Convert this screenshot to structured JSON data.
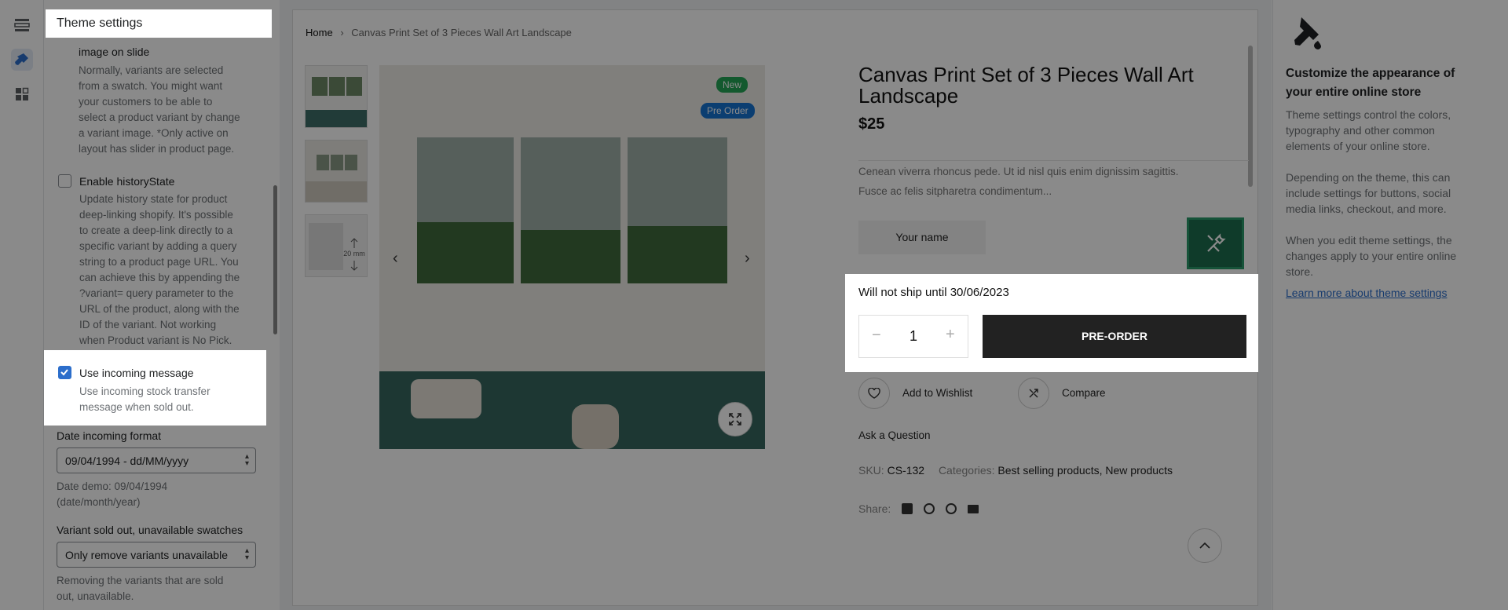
{
  "settings": {
    "title": "Theme settings",
    "variant_image_label": "image on slide",
    "variant_image_help": [
      "Normally, variants are selected",
      "from a swatch. You might want",
      "your customers to be able to",
      "select a product variant by change",
      "a variant image. *Only active on",
      "layout has slider in product page."
    ],
    "history_label": "Enable historyState",
    "history_help": [
      "Update history state for product",
      "deep-linking shopify. It's possible",
      "to create a deep-link directly to a",
      "specific variant by adding a query",
      "string to a product page URL. You",
      "can achieve this by appending the",
      "?variant= query parameter to the",
      "URL of the product, along with the",
      "ID of the variant. Not working",
      "when Product variant is No Pick."
    ],
    "incoming_label": "Use incoming message",
    "incoming_help": [
      "Use incoming stock transfer",
      "message when sold out."
    ],
    "date_format_label": "Date incoming format",
    "date_format_value": "09/04/1994 - dd/MM/yyyy",
    "date_demo": [
      "Date demo: 09/04/1994",
      "(date/month/year)"
    ],
    "soldout_label": "Variant sold out, unavailable swatches",
    "soldout_value": "Only remove variants unavailable",
    "soldout_help": [
      "Removing the variants that are sold",
      "out, unavailable."
    ]
  },
  "preview": {
    "breadcrumb": {
      "home": "Home",
      "sep": "›",
      "current": "Canvas Print Set of 3 Pieces Wall Art Landscape"
    },
    "badges": {
      "new": "New",
      "preorder": "Pre Order"
    },
    "product": {
      "title": [
        "Canvas Print Set of 3 Pieces Wall Art",
        "Landscape"
      ],
      "price": "$25",
      "description": [
        "Cenean viverra rhoncus pede. Ut id nisl quis enim dignissim sagittis.",
        "Fusce ac felis sitpharetra condimentum..."
      ],
      "your_name": "Your name",
      "ship_notice": "Will not ship until 30/06/2023",
      "qty": "1",
      "qty_minus": "−",
      "qty_plus": "+",
      "cta": "PRE-ORDER",
      "wishlist": "Add to Wishlist",
      "compare": "Compare",
      "ask": "Ask a Question",
      "sku_label": "SKU:",
      "sku": "CS-132",
      "categories_label": "Categories:",
      "categories": "Best selling products, New products",
      "share_label": "Share:",
      "thumb_size_text": "20 mm"
    }
  },
  "help": {
    "heading": [
      "Customize the appearance of",
      "your entire online store"
    ],
    "p1": [
      "Theme settings control the colors,",
      "typography and other common",
      "elements of your online store."
    ],
    "p2": [
      "Depending on the theme, this can",
      "include settings for buttons, social",
      "media links, checkout, and more."
    ],
    "p3": [
      "When you edit theme settings, the",
      "changes apply to your entire online",
      "store."
    ],
    "link": "Learn more about theme settings"
  },
  "colors": {
    "accent_blue": "#2c6ecb",
    "badge_green": "#23a455",
    "badge_blue": "#1673d1",
    "cta_dark": "#222222",
    "tool_green": "#1d6e4e"
  }
}
